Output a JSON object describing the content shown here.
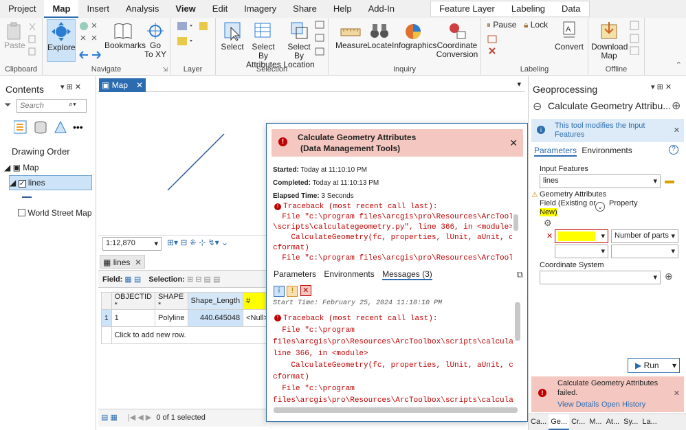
{
  "tabs": [
    "Project",
    "Map",
    "Insert",
    "Analysis",
    "View",
    "Edit",
    "Imagery",
    "Share",
    "Help",
    "Add-In"
  ],
  "context_tabs": [
    "Feature Layer",
    "Labeling",
    "Data"
  ],
  "ribbon": {
    "clipboard": {
      "label": "Clipboard",
      "paste": "Paste"
    },
    "navigate": {
      "label": "Navigate",
      "explore": "Explore",
      "bookmarks": "Bookmarks",
      "goto_line1": "Go",
      "goto_line2": "To XY"
    },
    "layer": {
      "label": "Layer"
    },
    "selection": {
      "label": "Selection",
      "select": "Select",
      "by_attr_line1": "Select By",
      "by_attr_line2": "Attributes",
      "by_loc_line1": "Select By",
      "by_loc_line2": "Location"
    },
    "inquiry": {
      "label": "Inquiry",
      "measure": "Measure",
      "locate": "Locate",
      "infographics": "Infographics",
      "coord_line1": "Coordinate",
      "coord_line2": "Conversion"
    },
    "labeling": {
      "label": "Labeling",
      "pause": "Pause",
      "lock": "Lock",
      "convert": "Convert"
    },
    "offline": {
      "label": "Offline",
      "download_line1": "Download",
      "download_line2": "Map"
    }
  },
  "contents": {
    "title": "Contents",
    "search_placeholder": "Search",
    "drawing_order": "Drawing Order",
    "map": "Map",
    "lines": "lines",
    "basemap": "World Street Map"
  },
  "map_view": {
    "tab": "Map",
    "scale": "1:12,870"
  },
  "table": {
    "tab": "lines",
    "field_label": "Field:",
    "selection_label": "Selection:",
    "columns": [
      "OBJECTID *",
      "SHAPE *",
      "Shape_Length",
      "#"
    ],
    "row": {
      "num": "1",
      "objectid": "1",
      "shape": "Polyline",
      "length": "440.645048",
      "extra": "<Null>"
    },
    "add_row": "Click to add new row.",
    "status": "0 of 1 selected"
  },
  "dialog": {
    "title_line1": "Calculate Geometry Attributes",
    "title_line2": "(Data Management Tools)",
    "started_label": "Started:",
    "started": "Today at 11:10:10 PM",
    "completed_label": "Completed:",
    "completed": "Today at 11:10:13 PM",
    "elapsed_label": "Elapsed Time:",
    "elapsed": "3 Seconds",
    "trace1": [
      "Traceback (most recent call last):",
      "  File \"c:\\program files\\arcgis\\pro\\Resources\\ArcToolbox",
      "\\scripts\\calculategeometry.py\", line 366, in <module>",
      "    CalculateGeometry(fc, properties, lUnit, aUnit, cs,",
      "cformat)",
      "  File \"c:\\program files\\arcgis\\pro\\Resources\\ArcToolbox",
      "\\scripts\\calculategeometry.py\", line 177, in"
    ],
    "tabs": [
      "Parameters",
      "Environments",
      "Messages (3)"
    ],
    "start_time": "Start Time: February 25, 2024 11:10:10 PM",
    "trace2": [
      "Traceback (most recent call last):",
      "  File \"c:\\program",
      "files\\arcgis\\pro\\Resources\\ArcToolbox\\scripts\\calculategeome",
      "line 366, in <module>",
      "    CalculateGeometry(fc, properties, lUnit, aUnit, cs,",
      "cformat)",
      "  File \"c:\\program",
      "files\\arcgis\\pro\\Resources\\ArcToolbox\\scripts\\calculategeome"
    ]
  },
  "gp": {
    "title": "Geoprocessing",
    "tool": "Calculate Geometry Attribu...",
    "info": "This tool modifies the Input Features",
    "tab_params": "Parameters",
    "tab_env": "Environments",
    "input_label": "Input Features",
    "input_value": "lines",
    "geom_label": "Geometry Attributes",
    "field_col_line1": "Field (Existing or",
    "field_col_line2": "New)",
    "property_col": "Property",
    "property_value": "Number of parts",
    "coord_label": "Coordinate System",
    "run": "Run",
    "fail_line1": "Calculate Geometry Attributes",
    "fail_line2": "failed.",
    "view_details": "View Details",
    "open_history": "Open History",
    "bottom_tabs": [
      "Ca...",
      "Ge...",
      "Cr...",
      "M...",
      "At...",
      "Sy...",
      "La..."
    ]
  },
  "colors": {
    "accent": "#2b6cb0",
    "error_bg": "#f4c7c0",
    "error_text": "#c00000",
    "highlight": "#ffff00",
    "info_bg": "#dcebf7"
  }
}
